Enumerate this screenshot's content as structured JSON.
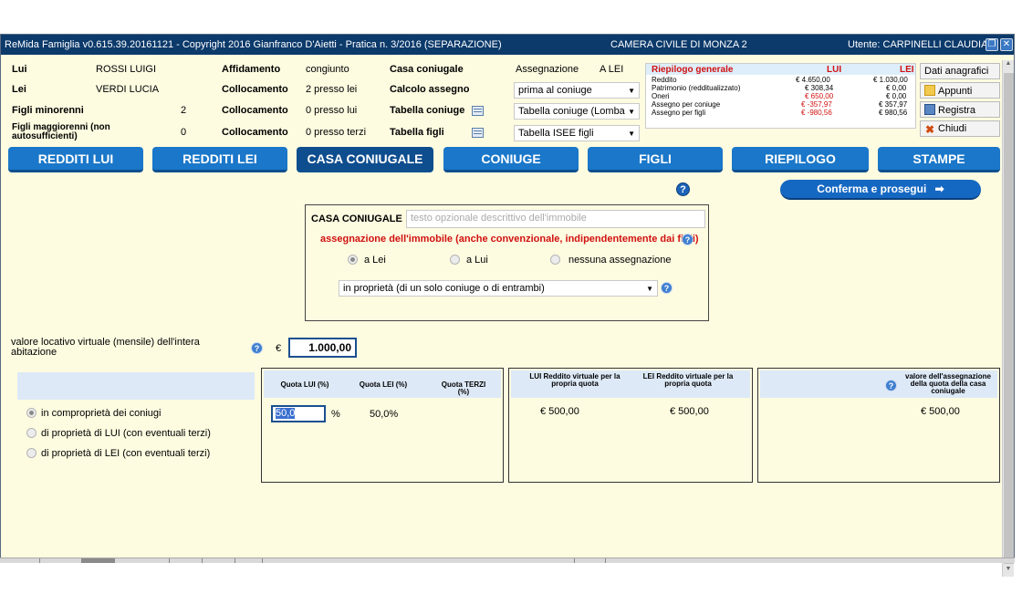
{
  "window": {
    "title": "ReMida Famiglia v0.615.39.20161121 - Copyright 2016 Gianfranco D'Aietti - Pratica n. 3/2016 (SEPARAZIONE)",
    "court": "CAMERA CIVILE DI MONZA 2",
    "user": "Utente: CARPINELLI CLAUDIA"
  },
  "header": {
    "lui_label": "Lui",
    "lui_name": "ROSSI LUIGI",
    "lei_label": "Lei",
    "lei_name": "VERDI LUCIA",
    "figli_min_label": "Figli minorenni",
    "figli_min_value": "2",
    "figli_mag_label": "Figli maggiorenni (non autosufficienti)",
    "figli_mag_value": "0",
    "affidamento_label": "Affidamento",
    "affidamento_value": "congiunto",
    "collocamento_label": "Collocamento",
    "collocamento_1": "2 presso lei",
    "collocamento_2": "0 presso lui",
    "collocamento_3": "0 presso terzi",
    "casa_label": "Casa coniugale",
    "assegnazione_label": "Assegnazione",
    "assegnazione_value": "A LEI",
    "calcolo_label": "Calcolo assegno",
    "calcolo_value": "prima al coniuge",
    "tab_coniuge_label": "Tabella coniuge",
    "tab_coniuge_value": "Tabella coniuge (Lomba",
    "tab_figli_label": "Tabella figli",
    "tab_figli_value": "Tabella ISEE figli"
  },
  "riepilogo": {
    "title": "Riepilogo generale",
    "col_lui": "LUI",
    "col_lei": "LEI",
    "rows": [
      {
        "label": "Reddito",
        "lui": "€ 4.650,00",
        "lei": "€ 1.030,00"
      },
      {
        "label": "Patrimonio (redditualizzato)",
        "lui": "€ 308,34",
        "lei": "€ 0,00"
      },
      {
        "label": "Oneri",
        "lui": "€ 650,00",
        "lei": "€ 0,00"
      },
      {
        "label": "Assegno per coniuge",
        "lui": "€ -357,97",
        "lei": "€ 357,97"
      },
      {
        "label": "Assegno per figli",
        "lui": "€ -980,56",
        "lei": "€ 980,56"
      }
    ]
  },
  "side_buttons": {
    "dati": "Dati anagrafici",
    "appunti": "Appunti",
    "registra": "Registra",
    "chiudi": "Chiudi"
  },
  "tabs": [
    "REDDITI LUI",
    "REDDITI LEI",
    "CASA CONIUGALE",
    "CONIUGE",
    "FIGLI",
    "RIEPILOGO",
    "STAMPE"
  ],
  "active_tab": "CASA CONIUGALE",
  "content": {
    "confirm_button": "Conferma e prosegui",
    "casa_label": "CASA CONIUGALE",
    "casa_placeholder": "testo opzionale descrittivo dell'immobile",
    "assegnazione_text": "assegnazione dell'immobile (anche convenzionale, indipendentemente dai figli)",
    "radio_options": [
      "a Lei",
      "a Lui",
      "nessuna assegnazione"
    ],
    "radio_selected": "a Lei",
    "proprieta_select": "in proprietà (di un solo coniuge o di entrambi)",
    "valore_label": "valore locativo virtuale (mensile) dell'intera abitazione",
    "currency": "€",
    "valore_value": "1.000,00",
    "ownership_options": [
      "in comproprietà dei coniugi",
      "di proprietà di LUI (con eventuali terzi)",
      "di proprietà di LEI (con eventuali terzi)"
    ],
    "ownership_selected": "in comproprietà dei coniugi",
    "quota_headers": [
      "Quota LUI (%)",
      "Quota LEI (%)",
      "Quota TERZI (%)"
    ],
    "quota_lui": "50,0",
    "percent_sign": "%",
    "quota_lei": "50,0%",
    "reddito_headers": [
      "LUI Reddito virtuale per la propria quota",
      "LEI Reddito virtuale per la propria quota"
    ],
    "reddito_lui": "€ 500,00",
    "reddito_lei": "€ 500,00",
    "valore_assegnazione_header": "valore dell'assegnazione della quota della casa coniugale",
    "valore_assegnazione": "€ 500,00"
  }
}
